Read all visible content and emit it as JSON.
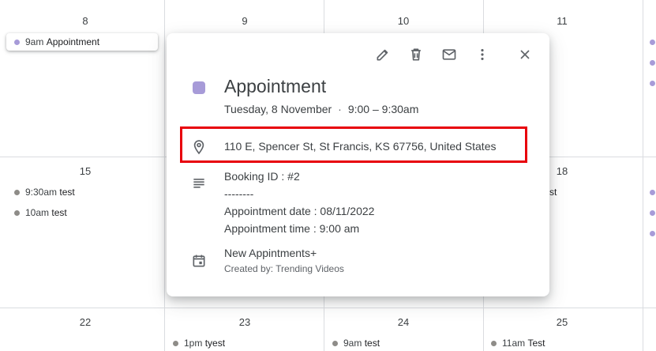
{
  "calendar": {
    "day_numbers": [
      "8",
      "9",
      "10",
      "11",
      "15",
      "18",
      "22",
      "23",
      "24",
      "25"
    ],
    "events": [
      {
        "time": "9am",
        "title": "Appointment",
        "color": "#a79bd8"
      },
      {
        "time": "9:30am",
        "title": "test",
        "color": "#8e8c88"
      },
      {
        "time": "10am",
        "title": "test",
        "color": "#8e8c88"
      },
      {
        "time": "",
        "title": "st",
        "color": "#8e8c88"
      },
      {
        "time": "1pm",
        "title": "tyest",
        "color": "#8e8c88"
      },
      {
        "time": "9am",
        "title": "test",
        "color": "#8e8c88"
      },
      {
        "time": "11am",
        "title": "Test",
        "color": "#8e8c88"
      }
    ],
    "side_dot_color": "#a79bd8"
  },
  "popup": {
    "toolbar": {
      "edit_icon": "pencil-icon",
      "delete_icon": "trash-icon",
      "email_icon": "envelope-icon",
      "more_icon": "vertical-dots-icon",
      "close_icon": "close-icon"
    },
    "event_color": "#a79bd8",
    "title": "Appointment",
    "date": "Tuesday, 8 November",
    "separator": "·",
    "time_range": "9:00 – 9:30am",
    "location_icon": "map-pin-icon",
    "location": "110 E, Spencer St, St Francis, KS 67756, United States",
    "highlight_color": "#e8000b",
    "description_icon": "notes-icon",
    "description_lines": [
      "Booking ID : #2",
      "--------",
      "Appointment date : 08/11/2022",
      "Appointment time : 9:00 am"
    ],
    "calendar_icon": "calendar-icon",
    "calendar_name": "New Appintments+",
    "created_by": "Created by: Trending Videos"
  }
}
